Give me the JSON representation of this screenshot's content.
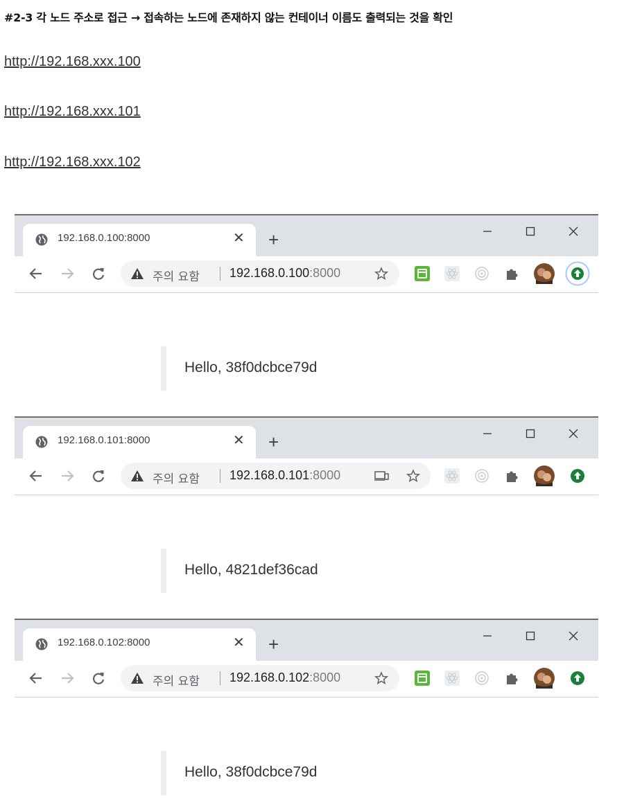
{
  "heading": "#2-3 각 노드 주소로 접근 → 접속하는 노드에 존재하지 않는 컨테이너 이름도 출력되는 것을 확인",
  "links": [
    "http://192.168.xxx.100",
    "http://192.168.xxx.101",
    "http://192.168.xxx.102"
  ],
  "screenshots": [
    {
      "tab_title": "192.168.0.100:8000",
      "security_label": "주의 요함",
      "url_host": "192.168.0.100",
      "url_port": ":8000",
      "page_text": "Hello, 38f0dcbce79d",
      "icons": [
        "globe-icon",
        "close-icon",
        "new-tab-icon",
        "minimize-icon",
        "maximize-icon",
        "window-close-icon",
        "back-icon",
        "forward-icon",
        "reload-icon",
        "warning-icon",
        "star-icon",
        "green-extension-icon",
        "react-devtools-icon",
        "target-extension-icon",
        "puzzle-icon",
        "avatar",
        "update-icon"
      ]
    },
    {
      "tab_title": "192.168.0.101:8000",
      "security_label": "주의 요함",
      "url_host": "192.168.0.101",
      "url_port": ":8000",
      "page_text": "Hello, 4821def36cad",
      "icons": [
        "globe-icon",
        "close-icon",
        "new-tab-icon",
        "minimize-icon",
        "maximize-icon",
        "window-close-icon",
        "back-icon",
        "forward-icon",
        "reload-icon",
        "warning-icon",
        "cast-icon",
        "star-icon",
        "react-devtools-icon",
        "target-extension-icon",
        "puzzle-icon",
        "avatar",
        "update-icon"
      ]
    },
    {
      "tab_title": "192.168.0.102:8000",
      "security_label": "주의 요함",
      "url_host": "192.168.0.102",
      "url_port": ":8000",
      "page_text": "Hello, 38f0dcbce79d",
      "icons": [
        "globe-icon",
        "close-icon",
        "new-tab-icon",
        "minimize-icon",
        "maximize-icon",
        "window-close-icon",
        "back-icon",
        "forward-icon",
        "reload-icon",
        "warning-icon",
        "star-icon",
        "green-extension-icon",
        "react-devtools-icon",
        "target-extension-icon",
        "puzzle-icon",
        "avatar",
        "update-icon"
      ]
    }
  ],
  "colors": {
    "tabbar_bg": "#dee1e6",
    "omnibox_bg": "#f1f3f4",
    "green_ext": "#5bb53b",
    "update_green": "#188038",
    "quote_bar": "#eeeeee"
  }
}
